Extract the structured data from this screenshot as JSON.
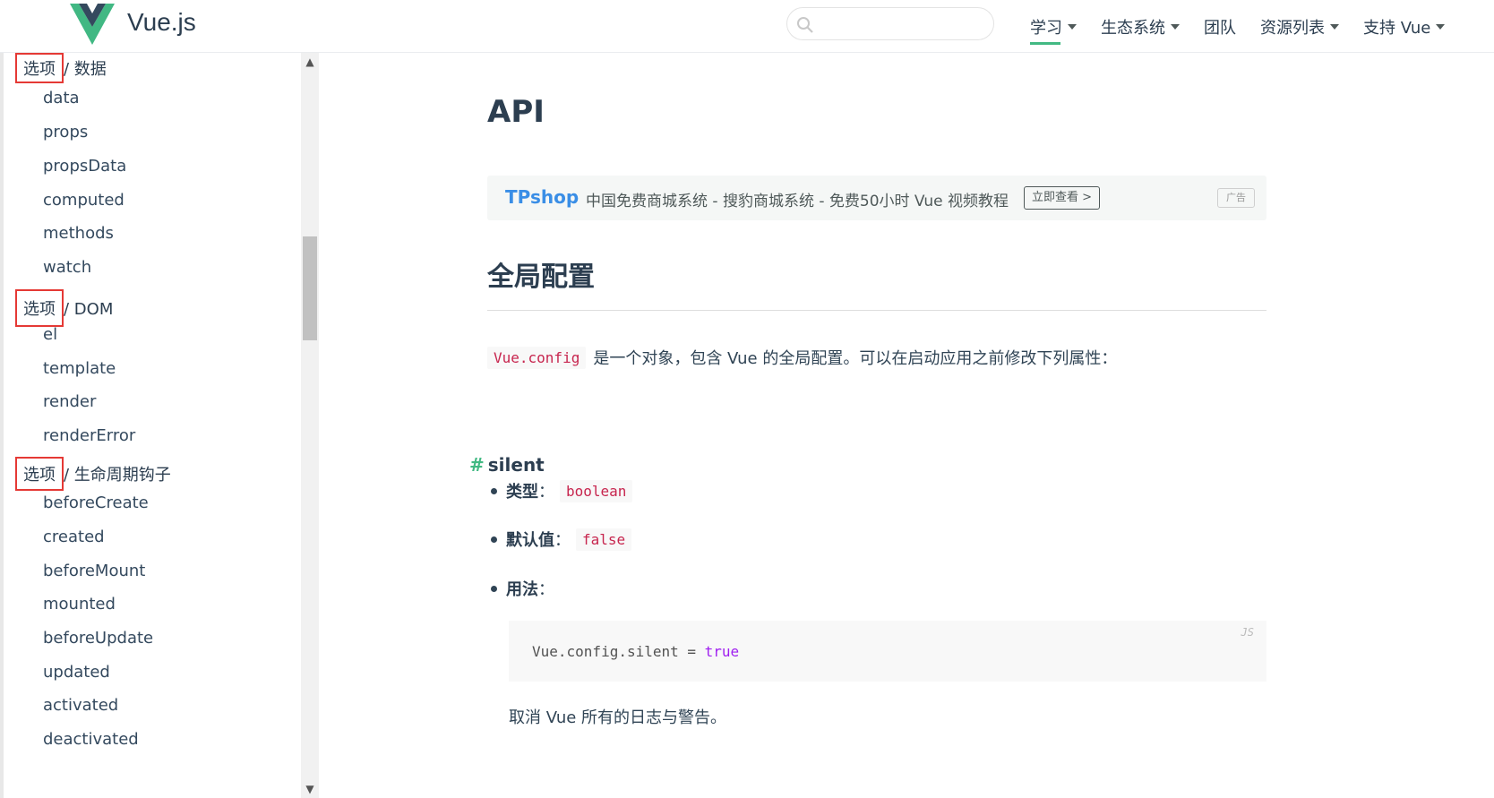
{
  "header": {
    "brand": "Vue.js",
    "search": {
      "value": "",
      "placeholder": ""
    },
    "nav": [
      {
        "label": "学习",
        "dropdown": true,
        "active": true
      },
      {
        "label": "生态系统",
        "dropdown": true
      },
      {
        "label": "团队",
        "dropdown": false
      },
      {
        "label": "资源列表",
        "dropdown": true
      },
      {
        "label": "支持 Vue",
        "dropdown": true
      }
    ]
  },
  "sidebar": {
    "sections": [
      {
        "prefix": "选项",
        "rest": "/ 数据",
        "items": [
          "data",
          "props",
          "propsData",
          "computed",
          "methods",
          "watch"
        ]
      },
      {
        "prefix": "选项",
        "rest": "/ DOM",
        "items": [
          "el",
          "template",
          "render",
          "renderError"
        ]
      },
      {
        "prefix": "选项",
        "rest": "/ 生命周期钩子",
        "items": [
          "beforeCreate",
          "created",
          "beforeMount",
          "mounted",
          "beforeUpdate",
          "updated",
          "activated",
          "deactivated"
        ]
      }
    ]
  },
  "main": {
    "title": "API",
    "ad": {
      "brand": "TPshop",
      "text": "中国免费商城系统 - 搜豹商城系统 - 免费50小时 Vue 视频教程",
      "button": "立即查看 >",
      "tag": "广告"
    },
    "section_title": "全局配置",
    "intro_code": "Vue.config",
    "intro_text": "是一个对象，包含 Vue 的全局配置。可以在启动应用之前修改下列属性：",
    "subsection": {
      "anchor": "#",
      "title": "silent"
    },
    "props": [
      {
        "label": "类型",
        "sep": "：",
        "code": "boolean"
      },
      {
        "label": "默认值",
        "sep": "：",
        "code": "false"
      },
      {
        "label": "用法",
        "sep": "：",
        "code": ""
      }
    ],
    "codeblock": {
      "lang": "JS",
      "code_prefix": "Vue.config.silent = ",
      "code_value": "true"
    },
    "description": "取消 Vue 所有的日志与警告。"
  },
  "colors": {
    "accent": "#42b983",
    "ad_brand": "#3a8ee6",
    "highlight_box": "#e53935"
  }
}
